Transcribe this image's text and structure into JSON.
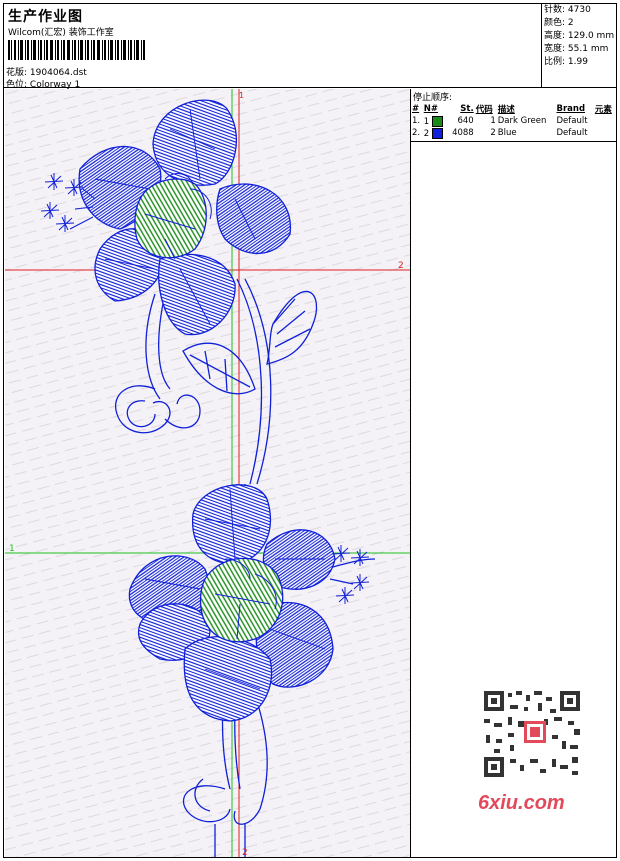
{
  "header": {
    "title": "生产作业图",
    "company": "Wilcom(汇宏) 装饰工作室",
    "design_label": "花版:",
    "design_value": "1904064.dst",
    "colorway_label": "色位:",
    "colorway_value": "Colorway 1"
  },
  "info": [
    {
      "label": "针数:",
      "value": "4730"
    },
    {
      "label": "颜色:",
      "value": "2"
    },
    {
      "label": "高度:",
      "value": "129.0 mm"
    },
    {
      "label": "宽度:",
      "value": "55.1 mm"
    },
    {
      "label": "比例:",
      "value": "1.99"
    }
  ],
  "stop_sequence": {
    "title": "停止顺序:",
    "headers": [
      "#",
      "N#",
      "St.",
      "代码",
      "描述",
      "Brand",
      "元素"
    ],
    "rows": [
      {
        "num": "1.",
        "n": "1",
        "color": "#1a8a1a",
        "st": "640",
        "code": "1",
        "desc": "Dark Green",
        "brand": "Default"
      },
      {
        "num": "2.",
        "n": "2",
        "color": "#1020d8",
        "st": "4088",
        "code": "2",
        "desc": "Blue",
        "brand": "Default"
      }
    ]
  },
  "guides": {
    "h1_label": "2",
    "h2_label": "1",
    "v_top_label": "1",
    "v_bottom_label": "2"
  },
  "logo": {
    "text": "6xiu.com"
  },
  "colors": {
    "thread_green": "#1a8a1a",
    "thread_blue": "#1020d8",
    "guide_red": "#e02020",
    "guide_green": "#20c020"
  }
}
